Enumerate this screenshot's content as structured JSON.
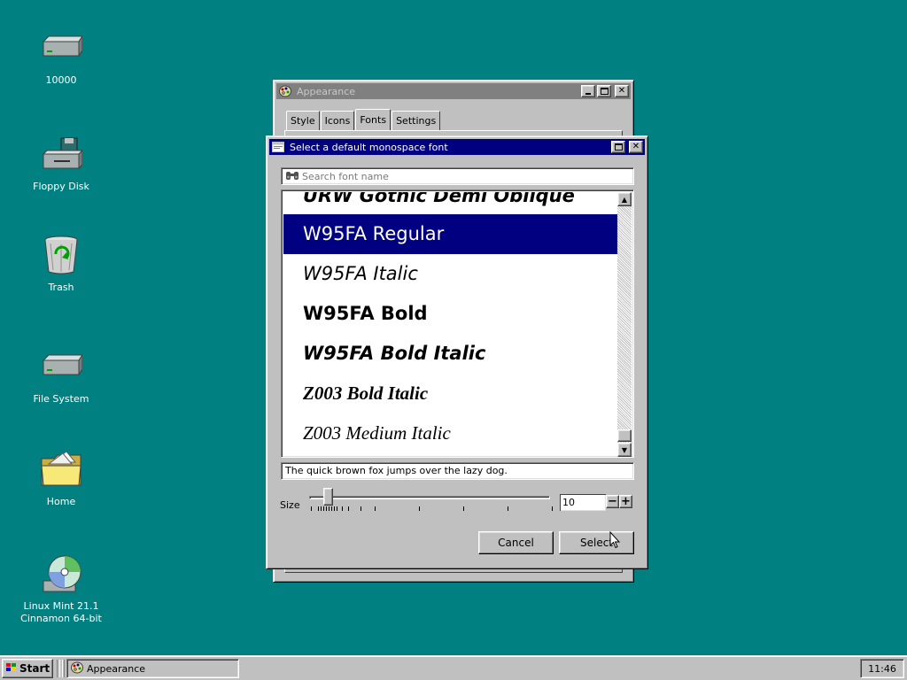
{
  "desktop": {
    "icons": [
      {
        "label": "10000",
        "icon": "drive-icon"
      },
      {
        "label": "Floppy Disk",
        "icon": "floppy-drive-icon"
      },
      {
        "label": "Trash",
        "icon": "trash-icon"
      },
      {
        "label": "File System",
        "icon": "drive-icon"
      },
      {
        "label": "Home",
        "icon": "folder-icon"
      },
      {
        "label": "Linux Mint 21.1\nCinnamon 64-bit",
        "icon": "cd-rom-icon"
      }
    ]
  },
  "appearance_window": {
    "title": "Appearance",
    "tabs": [
      {
        "label": "Style"
      },
      {
        "label": "Icons"
      },
      {
        "label": "Fonts",
        "active": true
      },
      {
        "label": "Settings"
      }
    ],
    "title_icon": "appearance-palette-icon"
  },
  "font_dialog": {
    "title": "Select a default monospace font",
    "search": {
      "placeholder": "Search font name",
      "value": ""
    },
    "fonts": [
      {
        "label": "URW Gothic Demi Oblique",
        "partial": true
      },
      {
        "label": "W95FA Regular",
        "selected": true
      },
      {
        "label": "W95FA Italic"
      },
      {
        "label": "W95FA Bold"
      },
      {
        "label": "W95FA Bold Italic"
      },
      {
        "label": "Z003 Bold Italic"
      },
      {
        "label": "Z003 Medium Italic"
      }
    ],
    "preview_text": "The quick brown fox jumps over the lazy dog.",
    "size": {
      "label": "Size",
      "value": "10",
      "slider_fraction": 0.06
    },
    "buttons": {
      "cancel": "Cancel",
      "select": "Select"
    }
  },
  "taskbar": {
    "start_label": "Start",
    "task_label": "Appearance",
    "clock": "11:46"
  },
  "colors": {
    "desktop": "#008080",
    "active_title": "#000080",
    "inactive_title": "#808080",
    "selection": "#000080",
    "face": "#c0c0c0"
  }
}
